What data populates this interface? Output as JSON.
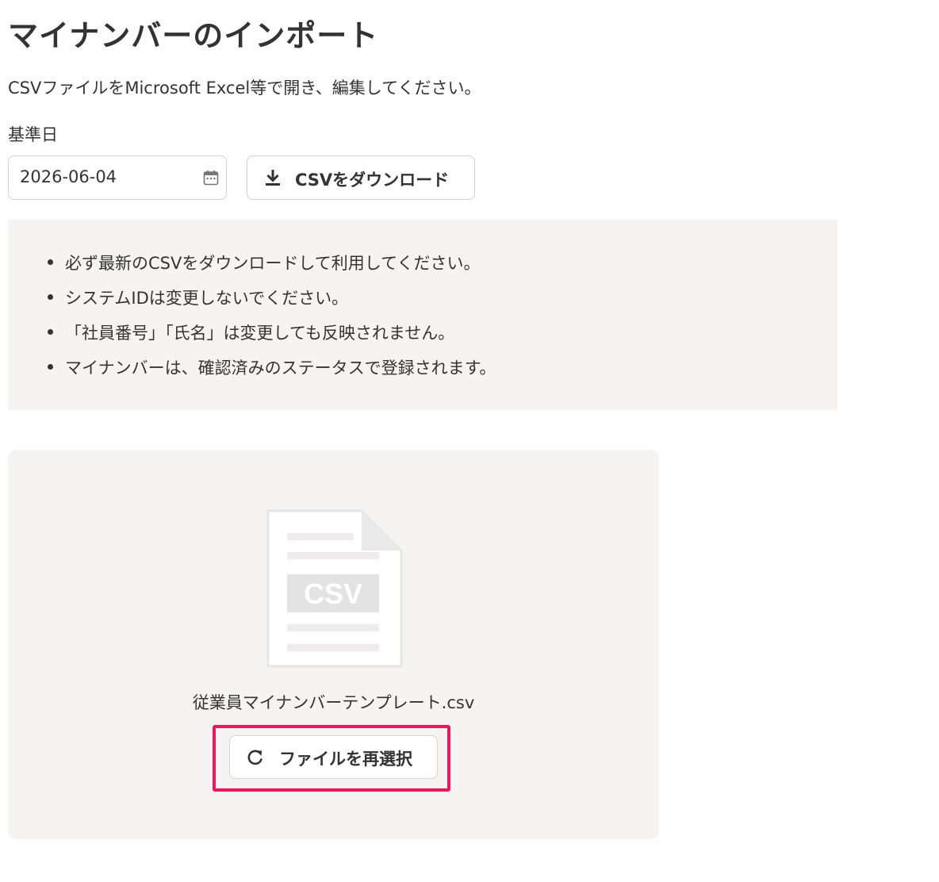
{
  "page": {
    "title": "マイナンバーのインポート",
    "description": "CSVファイルをMicrosoft Excel等で開き、編集してください。"
  },
  "date_field": {
    "label": "基準日",
    "value": "2026-06-04",
    "icon": "calendar-icon"
  },
  "download_button": {
    "label": "CSVをダウンロード",
    "icon": "download-icon"
  },
  "notes": [
    "必ず最新のCSVをダウンロードして利用してください。",
    "システムIDは変更しないでください。",
    "「社員番号」「氏名」は変更しても反映されません。",
    "マイナンバーは、確認済みのステータスで登録されます。"
  ],
  "upload": {
    "file_icon": "csv-file-icon",
    "file_icon_text": "CSV",
    "file_name": "従業員マイナンバーテンプレート.csv",
    "reselect_label": "ファイルを再選択",
    "reselect_icon": "refresh-icon"
  },
  "colors": {
    "highlight": "#f0155f",
    "panel_background": "#f5f4f2",
    "text": "#333333"
  }
}
